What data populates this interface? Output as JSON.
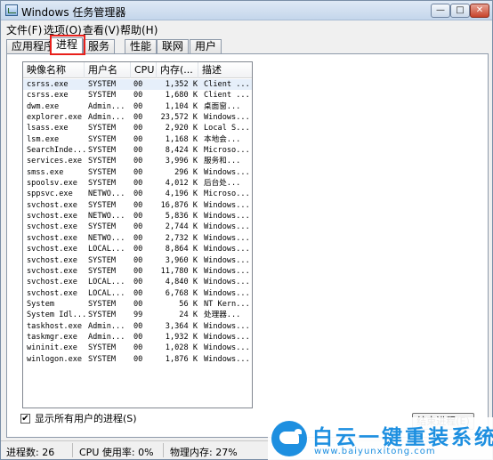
{
  "window": {
    "title": "Windows 任务管理器",
    "buttons": {
      "minimize": "—",
      "maximize": "□",
      "close": "✕"
    }
  },
  "menu": [
    {
      "label": "文件(F)"
    },
    {
      "label": "选项(O)"
    },
    {
      "label": "查看(V)"
    },
    {
      "label": "帮助(H)"
    }
  ],
  "tabs": [
    {
      "label": "应用程序",
      "active": false
    },
    {
      "label": "进程",
      "active": true
    },
    {
      "label": "服务",
      "active": false
    },
    {
      "label": "性能",
      "active": false
    },
    {
      "label": "联网",
      "active": false
    },
    {
      "label": "用户",
      "active": false
    }
  ],
  "columns": {
    "name": "映像名称",
    "user": "用户名",
    "cpu": "CPU",
    "memory": "内存(...",
    "description": "描述"
  },
  "processes": [
    {
      "name": "csrss.exe",
      "user": "SYSTEM",
      "cpu": "00",
      "memory": "1,352 K",
      "description": "Client ..."
    },
    {
      "name": "csrss.exe",
      "user": "SYSTEM",
      "cpu": "00",
      "memory": "1,680 K",
      "description": "Client ..."
    },
    {
      "name": "dwm.exe",
      "user": "Admin...",
      "cpu": "00",
      "memory": "1,104 K",
      "description": "桌面窗..."
    },
    {
      "name": "explorer.exe",
      "user": "Admin...",
      "cpu": "00",
      "memory": "23,572 K",
      "description": "Windows..."
    },
    {
      "name": "lsass.exe",
      "user": "SYSTEM",
      "cpu": "00",
      "memory": "2,920 K",
      "description": "Local S..."
    },
    {
      "name": "lsm.exe",
      "user": "SYSTEM",
      "cpu": "00",
      "memory": "1,168 K",
      "description": "本地会..."
    },
    {
      "name": "SearchInde...",
      "user": "SYSTEM",
      "cpu": "00",
      "memory": "8,424 K",
      "description": "Microso..."
    },
    {
      "name": "services.exe",
      "user": "SYSTEM",
      "cpu": "00",
      "memory": "3,996 K",
      "description": "服务和..."
    },
    {
      "name": "smss.exe",
      "user": "SYSTEM",
      "cpu": "00",
      "memory": "296 K",
      "description": "Windows..."
    },
    {
      "name": "spoolsv.exe",
      "user": "SYSTEM",
      "cpu": "00",
      "memory": "4,012 K",
      "description": "后台处..."
    },
    {
      "name": "sppsvc.exe",
      "user": "NETWO...",
      "cpu": "00",
      "memory": "4,196 K",
      "description": "Microso..."
    },
    {
      "name": "svchost.exe",
      "user": "SYSTEM",
      "cpu": "00",
      "memory": "16,876 K",
      "description": "Windows..."
    },
    {
      "name": "svchost.exe",
      "user": "NETWO...",
      "cpu": "00",
      "memory": "5,836 K",
      "description": "Windows..."
    },
    {
      "name": "svchost.exe",
      "user": "SYSTEM",
      "cpu": "00",
      "memory": "2,744 K",
      "description": "Windows..."
    },
    {
      "name": "svchost.exe",
      "user": "NETWO...",
      "cpu": "00",
      "memory": "2,732 K",
      "description": "Windows..."
    },
    {
      "name": "svchost.exe",
      "user": "LOCAL...",
      "cpu": "00",
      "memory": "8,864 K",
      "description": "Windows..."
    },
    {
      "name": "svchost.exe",
      "user": "SYSTEM",
      "cpu": "00",
      "memory": "3,960 K",
      "description": "Windows..."
    },
    {
      "name": "svchost.exe",
      "user": "SYSTEM",
      "cpu": "00",
      "memory": "11,780 K",
      "description": "Windows..."
    },
    {
      "name": "svchost.exe",
      "user": "LOCAL...",
      "cpu": "00",
      "memory": "4,840 K",
      "description": "Windows..."
    },
    {
      "name": "svchost.exe",
      "user": "LOCAL...",
      "cpu": "00",
      "memory": "6,768 K",
      "description": "Windows..."
    },
    {
      "name": "System",
      "user": "SYSTEM",
      "cpu": "00",
      "memory": "56 K",
      "description": "NT Kern..."
    },
    {
      "name": "System Idl...",
      "user": "SYSTEM",
      "cpu": "99",
      "memory": "24 K",
      "description": "处理器..."
    },
    {
      "name": "taskhost.exe",
      "user": "Admin...",
      "cpu": "00",
      "memory": "3,364 K",
      "description": "Windows..."
    },
    {
      "name": "taskmgr.exe",
      "user": "Admin...",
      "cpu": "00",
      "memory": "1,932 K",
      "description": "Windows..."
    },
    {
      "name": "wininit.exe",
      "user": "SYSTEM",
      "cpu": "00",
      "memory": "1,028 K",
      "description": "Windows..."
    },
    {
      "name": "winlogon.exe",
      "user": "SYSTEM",
      "cpu": "00",
      "memory": "1,876 K",
      "description": "Windows..."
    }
  ],
  "show_all_users": {
    "label": "显示所有用户的进程(S)",
    "checked": true,
    "check_glyph": "✔"
  },
  "end_process_button": "结束进程(E)",
  "status": {
    "processes": "进程数: 26",
    "cpu": "CPU 使用率: 0%",
    "memory": "物理内存: 27%"
  },
  "watermark": {
    "brand": "白云一键重装系统",
    "url": "www.baiyunxitong.com"
  },
  "colors": {
    "highlight_box": "#e8201b",
    "watermark_blue": "#1d8fe0",
    "selected_row": "#e6effa"
  }
}
